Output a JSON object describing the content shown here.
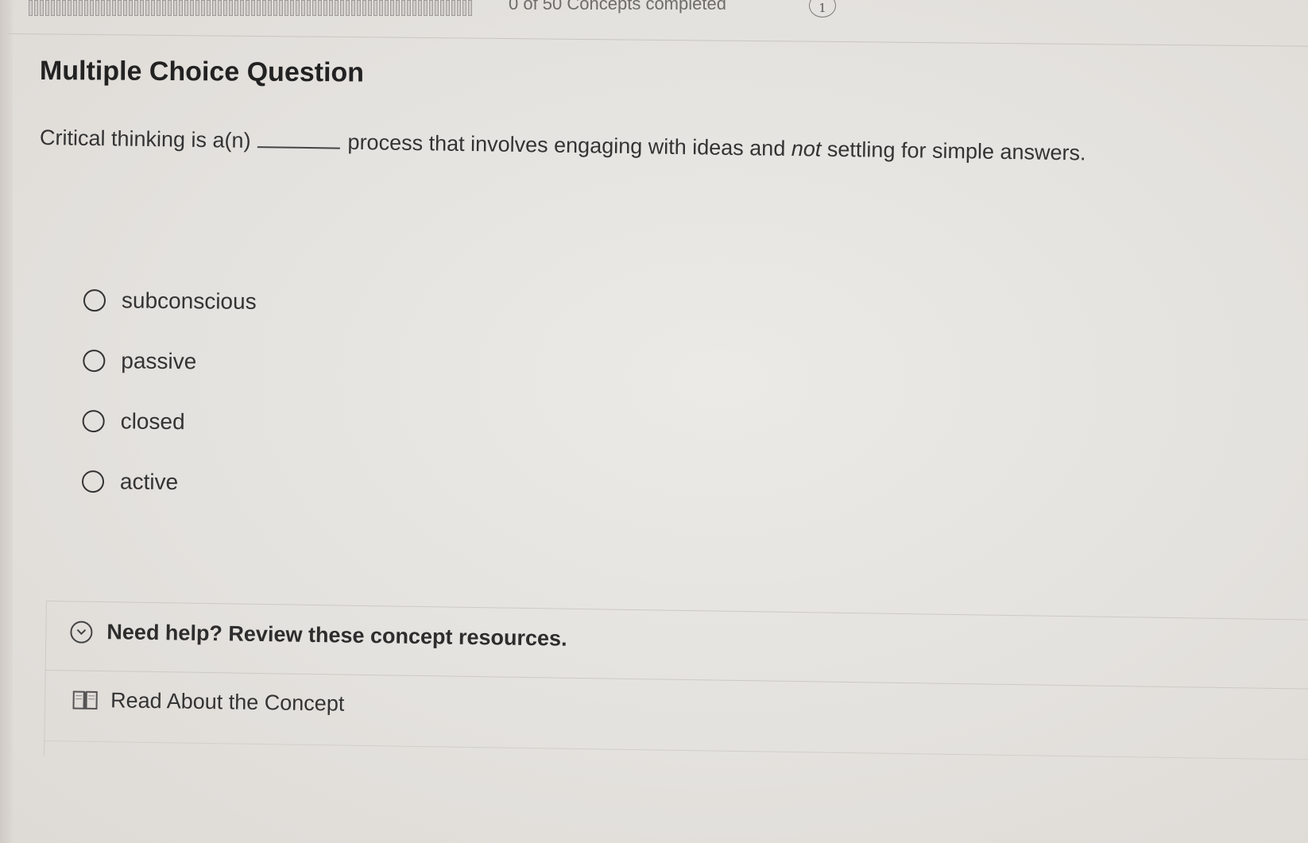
{
  "header": {
    "progress_text": "0 of 50 Concepts completed",
    "info_badge": "1",
    "progress_fraction": 0.0
  },
  "question": {
    "title": "Multiple Choice Question",
    "prompt_before": "Critical thinking is a(n)",
    "prompt_after_start": "process that involves engaging with ideas and",
    "prompt_emphasis": "not",
    "prompt_after_end": "settling for simple answers."
  },
  "options": [
    {
      "label": "subconscious",
      "selected": false
    },
    {
      "label": "passive",
      "selected": false
    },
    {
      "label": "closed",
      "selected": false
    },
    {
      "label": "active",
      "selected": false
    }
  ],
  "help": {
    "toggle_label": "Need help? Review these concept resources.",
    "toggle_icon": "chevron-down-circle-icon",
    "read_label": "Read About the Concept",
    "read_icon": "book-icon"
  }
}
